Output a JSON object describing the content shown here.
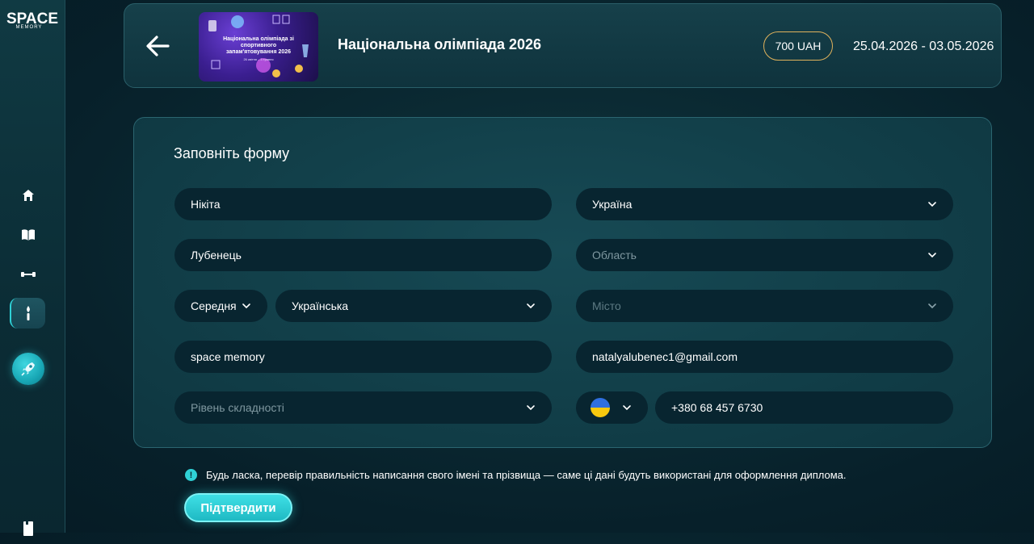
{
  "sidebar": {
    "logo_top": "SPACE",
    "logo_bottom": "MEMORY",
    "icons": [
      "home-icon",
      "book-icon",
      "dumbbell-icon",
      "torch-icon",
      "rocket-icon",
      "door-icon"
    ]
  },
  "header": {
    "title": "Національна олімпіада 2026",
    "banner_title": "Національна олімпіада зі спортивного запам'ятовування 2026",
    "banner_dates": "26 квітня – 3 травня",
    "price": "700 UAH",
    "dates": "25.04.2026 - 03.05.2026"
  },
  "form": {
    "title": "Заповніть форму",
    "first_name": "Нікіта",
    "last_name": "Лубенець",
    "school_type": "Середня",
    "language": "Українська",
    "organization": "space memory",
    "difficulty_placeholder": "Рівень складності",
    "country": "Україна",
    "region_placeholder": "Область",
    "city_placeholder": "Місто",
    "email": "natalyalubenec1@gmail.com",
    "phone": "+380 68 457 6730"
  },
  "notice": {
    "icon": "!",
    "text": "Будь ласка, перевір правильність написання свого імені та прізвища — саме ці дані будуть використані для оформлення диплома."
  },
  "submit_label": "Підтвердити",
  "colors": {
    "accent": "#2fd1d6",
    "price_border": "#e0b25c",
    "field_bg": "#082530"
  }
}
